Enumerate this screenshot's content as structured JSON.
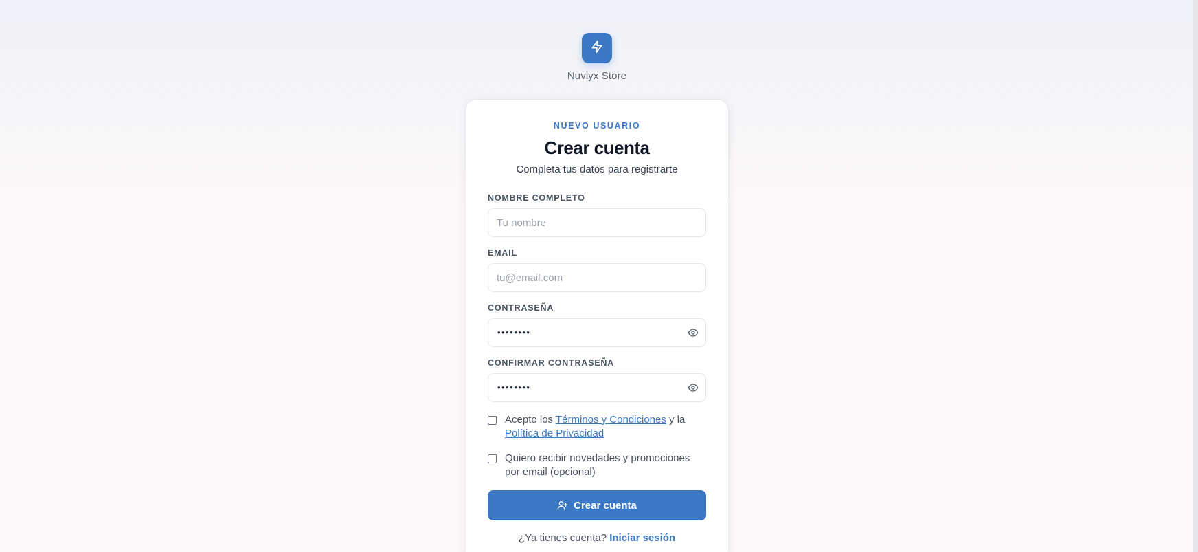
{
  "brand": {
    "name": "Nuvlyx Store",
    "logo_icon": "lightning-bolt-icon"
  },
  "card": {
    "eyebrow": "NUEVO USUARIO",
    "title": "Crear cuenta",
    "subtitle": "Completa tus datos para registrarte"
  },
  "fields": {
    "name": {
      "label": "NOMBRE COMPLETO",
      "placeholder": "Tu nombre",
      "value": ""
    },
    "email": {
      "label": "EMAIL",
      "placeholder": "tu@email.com",
      "value": ""
    },
    "password": {
      "label": "CONTRASEÑA",
      "masked_value": "••••••••",
      "toggle_icon": "eye-icon"
    },
    "confirm_password": {
      "label": "CONFIRMAR CONTRASEÑA",
      "masked_value": "••••••••",
      "toggle_icon": "eye-icon"
    }
  },
  "terms": {
    "prefix": "Acepto los ",
    "terms_link": "Términos y Condiciones",
    "middle": " y la",
    "privacy_link": "Política de Privacidad",
    "checked": false
  },
  "newsletter": {
    "text": "Quiero recibir novedades y promociones por email (opcional)",
    "checked": false
  },
  "submit": {
    "label": "Crear cuenta",
    "icon": "user-plus-icon"
  },
  "footer": {
    "question": "¿Ya tienes cuenta?",
    "link": "Iniciar sesión"
  },
  "colors": {
    "accent": "#3b78c4",
    "title": "#111827",
    "muted": "#4b5563"
  }
}
